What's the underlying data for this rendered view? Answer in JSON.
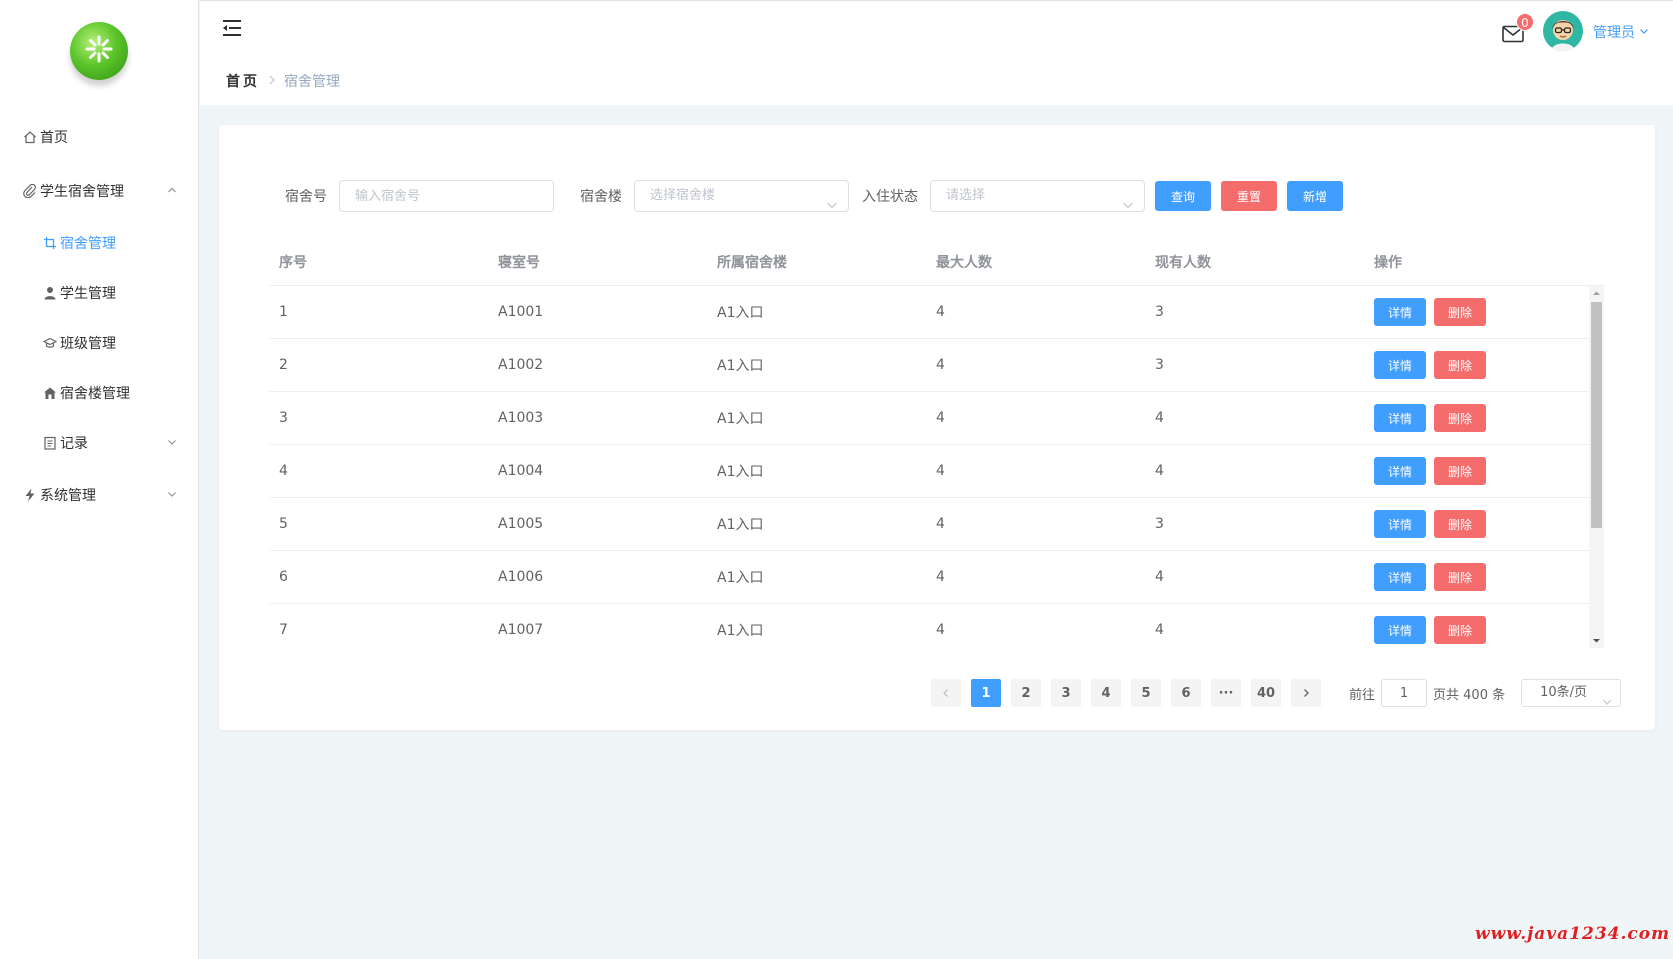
{
  "sidebar": {
    "items": [
      {
        "label": "首页",
        "icon": "home-icon"
      },
      {
        "label": "学生宿舍管理",
        "icon": "paperclip-icon"
      },
      {
        "label": "宿舍管理",
        "icon": "crop-icon"
      },
      {
        "label": "学生管理",
        "icon": "user-icon"
      },
      {
        "label": "班级管理",
        "icon": "graduation-cap-icon"
      },
      {
        "label": "宿舍楼管理",
        "icon": "house-icon"
      },
      {
        "label": "记录",
        "icon": "notebook-icon"
      },
      {
        "label": "系统管理",
        "icon": "lightning-icon"
      }
    ]
  },
  "header": {
    "breadcrumb_home": "首页",
    "breadcrumb_current": "宿舍管理",
    "message_count": "0",
    "user_name": "管理员"
  },
  "filter": {
    "dorm_no_label": "宿舍号",
    "dorm_no_placeholder": "输入宿舍号",
    "building_label": "宿舍楼",
    "building_placeholder": "选择宿舍楼",
    "status_label": "入住状态",
    "status_placeholder": "请选择",
    "search_label": "查询",
    "reset_label": "重置",
    "add_label": "新增"
  },
  "table": {
    "columns": [
      "序号",
      "寝室号",
      "所属宿舍楼",
      "最大人数",
      "现有人数",
      "操作"
    ],
    "detail_label": "详情",
    "delete_label": "删除",
    "rows": [
      [
        "1",
        "A1001",
        "A1入口",
        "4",
        "3"
      ],
      [
        "2",
        "A1002",
        "A1入口",
        "4",
        "3"
      ],
      [
        "3",
        "A1003",
        "A1入口",
        "4",
        "4"
      ],
      [
        "4",
        "A1004",
        "A1入口",
        "4",
        "4"
      ],
      [
        "5",
        "A1005",
        "A1入口",
        "4",
        "3"
      ],
      [
        "6",
        "A1006",
        "A1入口",
        "4",
        "4"
      ],
      [
        "7",
        "A1007",
        "A1入口",
        "4",
        "4"
      ]
    ]
  },
  "pagination": {
    "pages": [
      "1",
      "2",
      "3",
      "4",
      "5",
      "6",
      "···",
      "40"
    ],
    "current_page": "1",
    "goto_label": "前往",
    "goto_value": "1",
    "total_label": "页共 400 条",
    "page_size": "10条/页"
  },
  "watermark": "www.java1234.com",
  "colors": {
    "primary": "#409eff",
    "danger": "#f56c6c",
    "background": "#f0f5f8"
  }
}
